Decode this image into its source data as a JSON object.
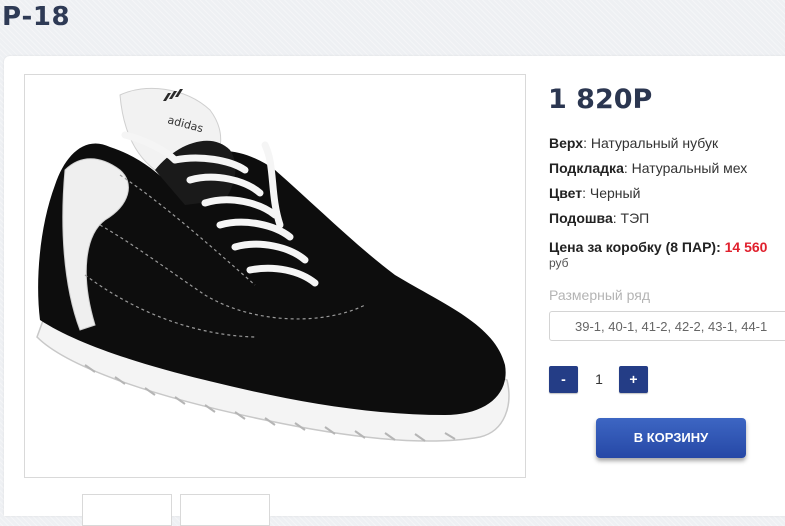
{
  "product": {
    "title": "Р-18",
    "price": "1 820Р",
    "image_alt": "adidas"
  },
  "specs": [
    {
      "key": "Верх",
      "value": "Натуральный нубук"
    },
    {
      "key": "Подкладка",
      "value": "Натуральный мех"
    },
    {
      "key": "Цвет",
      "value": "Черный"
    },
    {
      "key": "Подошва",
      "value": "ТЭП"
    }
  ],
  "box": {
    "label": "Цена за коробку (8 ПАР):",
    "value": "14 560",
    "currency": "руб"
  },
  "size": {
    "label": "Размерный ряд",
    "selected": "39-1, 40-1, 41-2, 42-2, 43-1, 44-1"
  },
  "quantity": {
    "minus": "-",
    "value": "1",
    "plus": "+"
  },
  "cart_button": "В КОРЗИНУ",
  "colors": {
    "accent": "#243d86",
    "cart": "#2f55b5",
    "price_red": "#e0202d",
    "title": "#2e3a55"
  }
}
